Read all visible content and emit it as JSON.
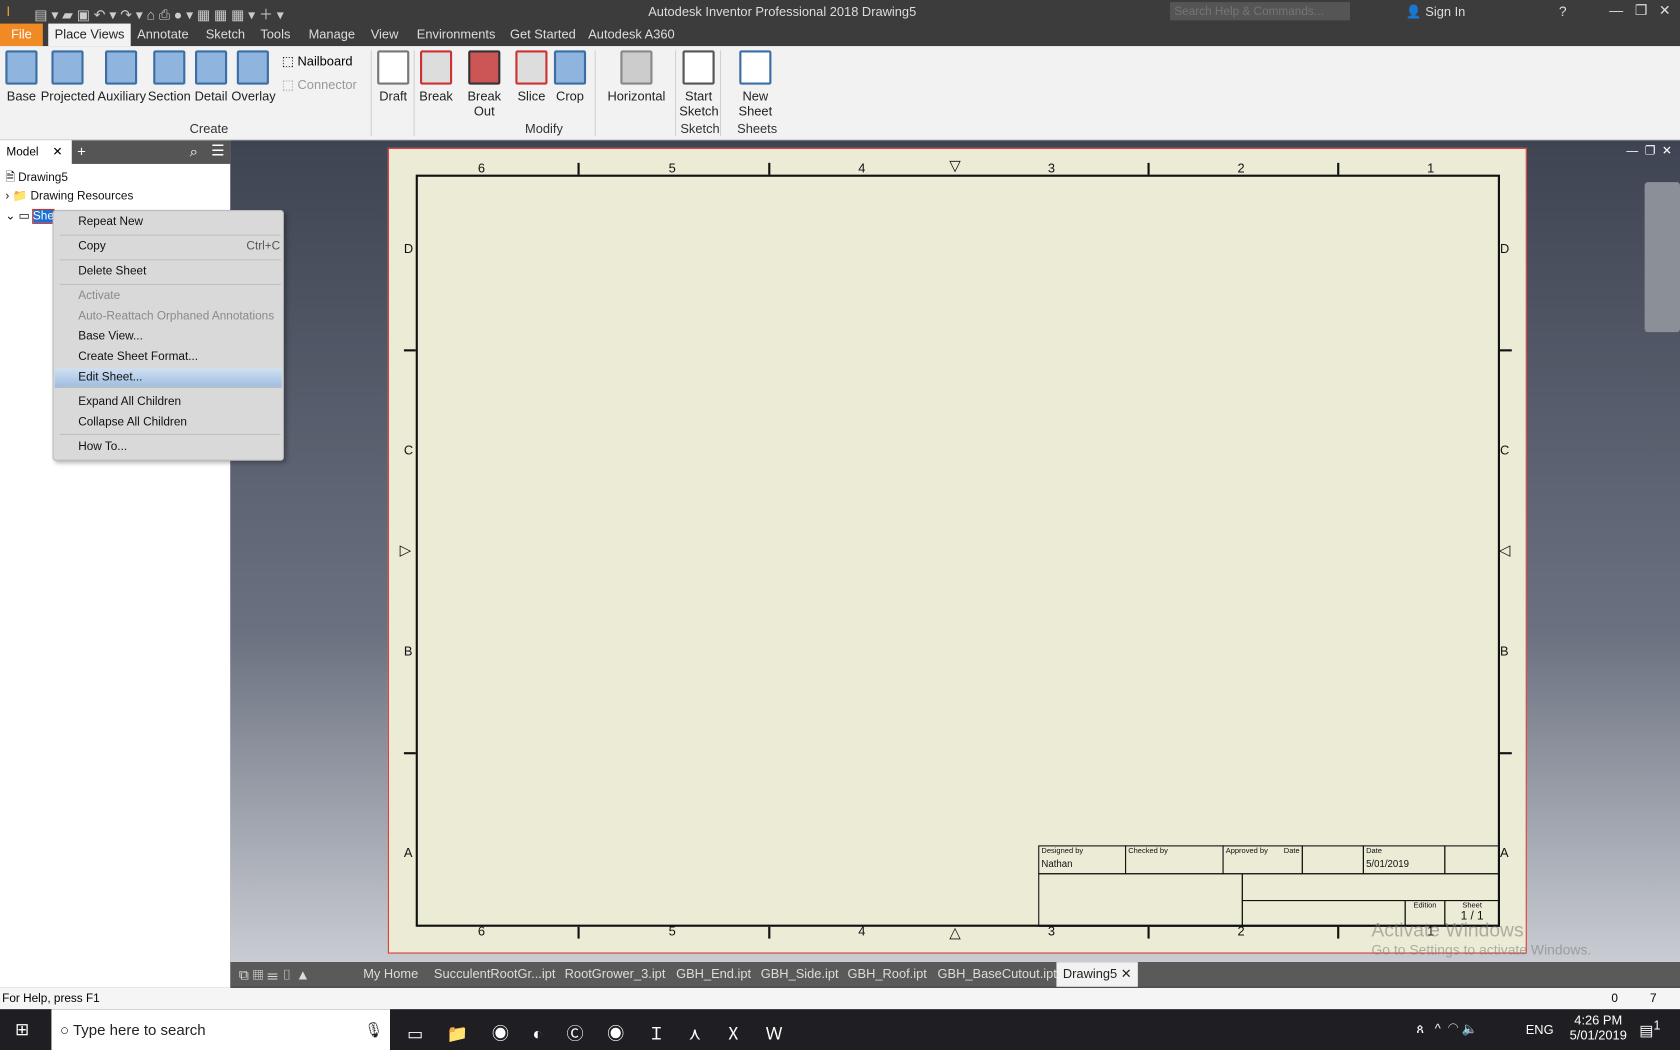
{
  "title": "Autodesk Inventor Professional 2018    Drawing5",
  "search_placeholder": "Search Help & Commands...",
  "sign_in": "Sign In",
  "tabs": [
    "File",
    "Place Views",
    "Annotate",
    "Sketch",
    "Tools",
    "Manage",
    "View",
    "Environments",
    "Get Started",
    "Autodesk A360"
  ],
  "ribbon": {
    "create": [
      "Base",
      "Projected",
      "Auxiliary",
      "Section",
      "Detail",
      "Overlay"
    ],
    "small": [
      "Nailboard",
      "Connector"
    ],
    "draft": "Draft",
    "modify": [
      "Break",
      "Break Out",
      "Slice",
      "Crop"
    ],
    "horizontal": "Horizontal",
    "start_sketch": "Start Sketch",
    "new_sheet": "New Sheet",
    "groups": [
      "Create",
      "Modify",
      "Sketch",
      "Sheets"
    ]
  },
  "panel": {
    "tab": "Model",
    "tree": [
      "Drawing5",
      "Drawing Resources",
      "She"
    ]
  },
  "context_menu": [
    {
      "label": "Repeat New"
    },
    {
      "label": "Copy",
      "shortcut": "Ctrl+C"
    },
    {
      "label": "Delete Sheet"
    },
    {
      "label": "Activate",
      "disabled": true
    },
    {
      "label": "Auto-Reattach Orphaned Annotations",
      "disabled": true
    },
    {
      "label": "Base View..."
    },
    {
      "label": "Create Sheet Format..."
    },
    {
      "label": "Edit Sheet...",
      "highlighted": true
    },
    {
      "label": "Expand All Children"
    },
    {
      "label": "Collapse All Children"
    },
    {
      "label": "How To..."
    }
  ],
  "zones": {
    "cols": [
      "6",
      "5",
      "4",
      "3",
      "2",
      "1"
    ],
    "rows": [
      "D",
      "C",
      "B",
      "A"
    ]
  },
  "title_block": {
    "designed_by": "Designed by",
    "designer": "Nathan",
    "checked_by": "Checked by",
    "approved_by": "Approved by",
    "date1": "Date",
    "date2": "Date",
    "date_value": "5/01/2019",
    "edition": "Edition",
    "sheet": "Sheet",
    "sheet_value": "1 / 1"
  },
  "watermark": {
    "line1": "Activate Windows",
    "line2": "Go to Settings to activate Windows."
  },
  "doc_tabs": [
    "My Home",
    "SucculentRootGr...ipt",
    "RootGrower_3.ipt",
    "GBH_End.ipt",
    "GBH_Side.ipt",
    "GBH_Roof.ipt",
    "GBH_BaseCutout.ipt",
    "Drawing5"
  ],
  "status": {
    "help": "For Help, press F1",
    "n1": "0",
    "n2": "7"
  },
  "taskbar": {
    "search": "Type here to search",
    "lang": "ENG",
    "time": "4:26 PM",
    "date": "5/01/2019",
    "notif": "1"
  },
  "colors": {
    "accent": "#f08a24",
    "sheet": "#ecebd6",
    "highlight": "#b6cde8"
  }
}
